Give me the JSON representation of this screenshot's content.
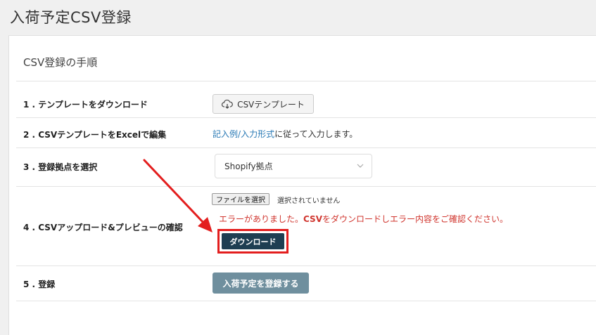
{
  "page": {
    "title": "入荷予定CSV登録"
  },
  "panel": {
    "heading": "CSV登録の手順"
  },
  "steps": [
    {
      "label": "1 . テンプレートをダウンロード"
    },
    {
      "label": "2 . CSVテンプレートをExcelで編集"
    },
    {
      "label": "3 . 登録拠点を選択"
    },
    {
      "label": "4 . CSVアップロード&プレビューの確認"
    },
    {
      "label": "5 . 登録"
    }
  ],
  "template_button": {
    "label": "CSVテンプレート",
    "icon": "cloud-download-icon"
  },
  "step2": {
    "link_example": "記入例",
    "separator": "/",
    "link_format": "入力形式",
    "suffix": "に従って入力します。"
  },
  "location_select": {
    "value": "Shopify拠点"
  },
  "file_input": {
    "button_label": "ファイルを選択",
    "status": "選択されていません"
  },
  "error": {
    "prefix": "エラーがありました。",
    "csv": "CSV",
    "suffix": "をダウンロードしエラー内容をご確認ください。"
  },
  "download_button": {
    "label": "ダウンロード"
  },
  "submit_button": {
    "label": "入荷予定を登録する"
  },
  "colors": {
    "error": "#d0352e",
    "highlight": "#e31e1e",
    "download_bg": "#1e3e52",
    "submit_bg": "#6f8f9e",
    "link": "#2a7ab5"
  }
}
